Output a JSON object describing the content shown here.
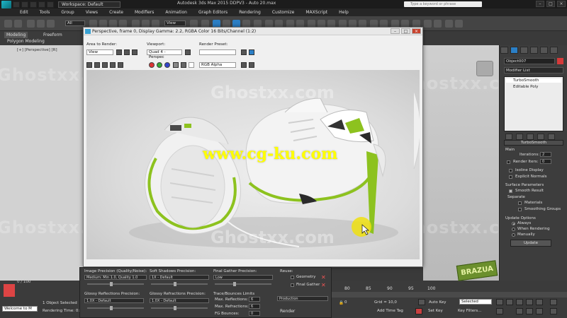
{
  "titlebar": {
    "workspace": "Workspace: Default",
    "title": "Autodesk 3ds Max 2015     DDPV3 - Auto 20.max",
    "search_placeholder": "Type a keyword or phrase"
  },
  "menu": [
    "Edit",
    "Tools",
    "Group",
    "Views",
    "Create",
    "Modifiers",
    "Animation",
    "Graph Editors",
    "Rendering",
    "Customize",
    "MAXScript",
    "Help"
  ],
  "toolbar": {
    "view_dropdown": "View",
    "filter_dropdown": "All"
  },
  "ribbon": {
    "tabs": [
      "Modeling",
      "Freeform"
    ],
    "subtitle": "Polygon Modeling"
  },
  "viewport": {
    "label": "[+] [Perspective] [R]"
  },
  "frame_window": {
    "title": "Perspective, frame 0, Display Gamma: 2.2, RGBA Color 16 Bits/Channel (1:2)",
    "area_to_render_label": "Area to Render:",
    "area_to_render": "View",
    "viewport_label": "Viewport:",
    "viewport": "Quad 4 - Perspec",
    "render_preset_label": "Render Preset:",
    "render_preset": "",
    "channel": "RGB Alpha"
  },
  "watermarks": {
    "ghost": "Ghostxx.com",
    "center": "www.cg-ku.com"
  },
  "command_panel": {
    "object_name": "Object007",
    "modifier_list": "Modifier List",
    "stack": [
      "TurboSmooth",
      "Editable Poly"
    ],
    "rollout_title": "TurboSmooth",
    "main_label": "Main",
    "iterations_label": "Iterations:",
    "iterations": "2",
    "render_iters_label": "Render Iters:",
    "render_iters": "0",
    "isoline_display": "Isoline Display",
    "explicit_normals": "Explicit Normals",
    "surface_params": "Surface Parameters",
    "smooth_result": "Smooth Result",
    "separate_label": "Separate",
    "materials": "Materials",
    "smoothing_groups": "Smoothing Groups",
    "update_options": "Update Options",
    "always": "Always",
    "when_rendering": "When Rendering",
    "manually": "Manually",
    "update_button": "Update"
  },
  "settings": {
    "image_precision_label": "Image Precision (Quality/Noise):",
    "image_precision": "Medium: Min 1.0, Quality 1.0",
    "soft_shadows_label": "Soft Shadows Precision:",
    "soft_shadows": "1X - Default",
    "final_gather_label": "Final Gather Precision:",
    "final_gather": "Low",
    "reuse_label": "Reuse:",
    "geometry": "Geometry",
    "final_gather_chk": "Final Gather",
    "glossy_reflections_label": "Glossy Reflections Precision:",
    "glossy_reflections": "1.0X - Default",
    "glossy_refractions_label": "Glossy Refractions Precision:",
    "glossy_refractions": "1.0X - Default",
    "trace_label": "Trace/Bounces Limits",
    "max_reflections_label": "Max. Reflections:",
    "max_reflections": "6",
    "max_refractions_label": "Max. Refractions:",
    "max_refractions": "6",
    "fg_bounces_label": "FG Bounces:",
    "fg_bounces": "0",
    "production": "Production",
    "render_button": "Render"
  },
  "status": {
    "frame_counter": "0 / 100",
    "maxscript": "Welcome to M",
    "objects": "1 Object Selected",
    "render_time": "Rendering Time: 0:01:"
  },
  "timeline": {
    "ticks": [
      "80",
      "85",
      "90",
      "95",
      "100"
    ],
    "grid": "Grid = 10,0",
    "auto_key": "Auto Key",
    "selected": "Selected",
    "set_key": "Set Key",
    "key_filters": "Key Filters...",
    "add_time_tag": "Add Time Tag",
    "frame_field": "0",
    "brand": "BRAZUA"
  },
  "colors": {
    "accent": "#2b7fc6",
    "shoe_green": "#8dc21f",
    "cursor_highlight": "#f0e010"
  }
}
